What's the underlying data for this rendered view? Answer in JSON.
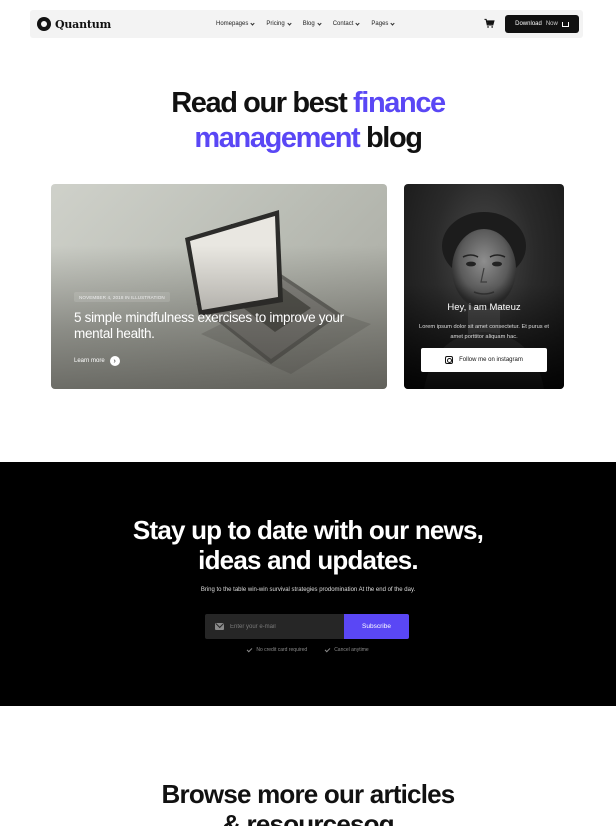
{
  "nav": {
    "logo_text": "Quantum",
    "menu": [
      {
        "label": "Homepages"
      },
      {
        "label": "Pricing"
      },
      {
        "label": "Blog"
      },
      {
        "label": "Contact"
      },
      {
        "label": "Pages"
      }
    ],
    "cart_icon": "cart-icon",
    "download_label": "Download",
    "download_label_suffix": "Now"
  },
  "hero": {
    "title_part1": "Read our best ",
    "title_accent1": "finance",
    "title_accent2": "management",
    "title_part2": " blog",
    "accent_color": "#5a47f5"
  },
  "featured_post": {
    "meta": "NOVEMBER 4, 2018 IN ILLUSTRATION",
    "title": "5 simple mindfulness exercises to improve your mental health.",
    "learn_more": "Learn more"
  },
  "profile": {
    "name": "Hey, i am Mateuz",
    "description": "Lorem ipsum dolor sit amet consectetur. Et purus et amet porttitor aliquam hac.",
    "button_label": "Follow me on instagram"
  },
  "newsletter": {
    "title_line1": "Stay up to date with our news,",
    "title_line2": "ideas and updates.",
    "subtitle": "Bring to the table win-win survival strategies prodomination At the end of the day.",
    "email_placeholder": "Enter your e-mail",
    "subscribe_label": "Subscribe",
    "notes": [
      "No credit card required",
      "Cancel anytime"
    ]
  },
  "browse": {
    "title_line1": "Browse more our articles",
    "title_line2": "& resourcesog"
  }
}
